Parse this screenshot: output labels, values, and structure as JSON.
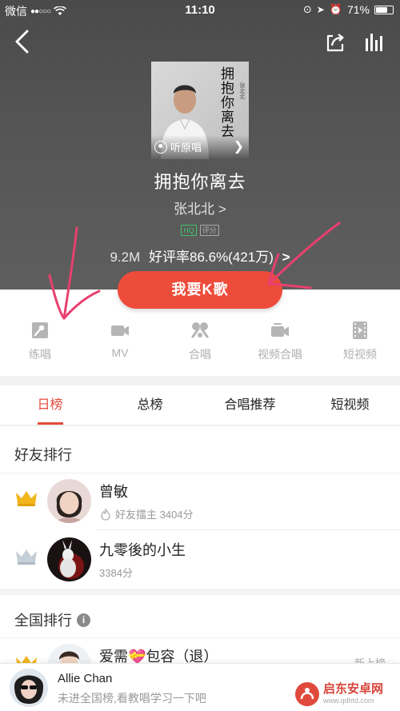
{
  "status_bar": {
    "carrier": "微信",
    "signal": "●●○○○",
    "time": "11:10",
    "battery": "71%",
    "battery_level": 0.71
  },
  "header": {
    "back_icon": "back-arrow-icon",
    "share_icon": "share-icon",
    "ranking_icon": "bar-chart-icon"
  },
  "song": {
    "cover_title": "拥抱你离去",
    "cover_artist": "张北北",
    "listen_original": "听原唱",
    "title": "拥抱你离去",
    "artist": "张北北 >",
    "badge_hq": "HQ",
    "badge_score": "评分",
    "plays": "9.2M",
    "rating": "好评率86.6%(421万)",
    "rating_arrow": ">"
  },
  "k_button": {
    "label": "我要K歌"
  },
  "actions": [
    {
      "label": "练唱",
      "icon": "practice-icon"
    },
    {
      "label": "MV",
      "icon": "video-camera-icon"
    },
    {
      "label": "合唱",
      "icon": "chorus-icon"
    },
    {
      "label": "视频合唱",
      "icon": "video-chorus-icon"
    },
    {
      "label": "短视频",
      "icon": "film-icon"
    }
  ],
  "tabs": [
    {
      "label": "日榜",
      "active": true
    },
    {
      "label": "总榜",
      "active": false
    },
    {
      "label": "合唱推荐",
      "active": false
    },
    {
      "label": "短视频",
      "active": false
    }
  ],
  "friends_section": {
    "title": "好友排行"
  },
  "friends": [
    {
      "name": "曾敏",
      "sub": "好友擂主 3404分",
      "crown": "gold-crown-icon"
    },
    {
      "name": "九零後的小生",
      "sub": "3384分",
      "crown": "silver-crown-icon"
    }
  ],
  "national_section": {
    "title": "全国排行",
    "info_icon": "i"
  },
  "national_first": {
    "name": "爱需💝包容（退）",
    "tag": "新上榜"
  },
  "bottom_bar": {
    "name": "Allie Chan",
    "hint": "未进全国榜,看教唱学习一下吧"
  },
  "watermark": {
    "title": "启东安卓网",
    "url": "www.qdhtd.com"
  },
  "colors": {
    "accent": "#ee4c3b",
    "tab_active": "#e34a3a",
    "hq": "#44c26c",
    "annotation": "#e8406e"
  }
}
